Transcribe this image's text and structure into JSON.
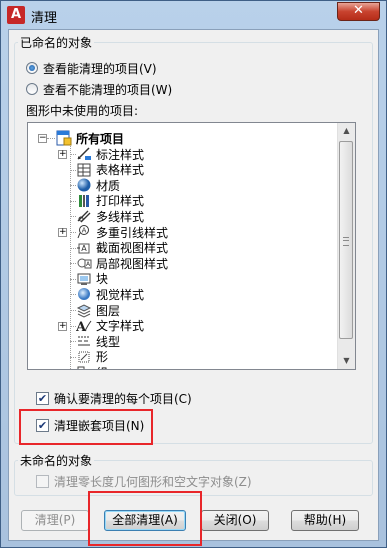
{
  "window": {
    "title": "清理",
    "app_icon_letter": "A",
    "close_glyph": "✕"
  },
  "named_objects": {
    "group_label": "已命名的对象",
    "radio_purgeable": {
      "label": "查看能清理的项目(V)",
      "selected": true
    },
    "radio_unpurgeable": {
      "label": "查看不能清理的项目(W)",
      "selected": false
    },
    "tree_label": "图形中未使用的项目:",
    "tree": {
      "root": {
        "label": "所有项目",
        "icon": "all-items-icon",
        "expander": "−"
      },
      "items": [
        {
          "label": "标注样式",
          "icon": "dimension-style-icon",
          "expandable": true
        },
        {
          "label": "表格样式",
          "icon": "table-style-icon",
          "expandable": false
        },
        {
          "label": "材质",
          "icon": "material-sphere-icon",
          "expandable": false
        },
        {
          "label": "打印样式",
          "icon": "plot-style-icon",
          "expandable": false
        },
        {
          "label": "多线样式",
          "icon": "multiline-style-icon",
          "expandable": false
        },
        {
          "label": "多重引线样式",
          "icon": "multileader-style-icon",
          "expandable": true
        },
        {
          "label": "截面视图样式",
          "icon": "section-view-style-icon",
          "expandable": false
        },
        {
          "label": "局部视图样式",
          "icon": "detail-view-style-icon",
          "expandable": false
        },
        {
          "label": "块",
          "icon": "block-icon",
          "expandable": false
        },
        {
          "label": "视觉样式",
          "icon": "visual-style-icon",
          "expandable": false
        },
        {
          "label": "图层",
          "icon": "layer-icon",
          "expandable": false
        },
        {
          "label": "文字样式",
          "icon": "text-style-icon",
          "expandable": true
        },
        {
          "label": "线型",
          "icon": "linetype-icon",
          "expandable": false
        },
        {
          "label": "形",
          "icon": "shape-icon",
          "expandable": false
        },
        {
          "label": "组",
          "icon": "group-icon",
          "expandable": false
        }
      ]
    },
    "confirm_each": {
      "label": "确认要清理的每个项目(C)",
      "checked": true
    },
    "purge_nested": {
      "label": "清理嵌套项目(N)",
      "checked": true
    }
  },
  "unnamed_objects": {
    "group_label": "未命名的对象",
    "purge_zero_length": {
      "label": "清理零长度几何图形和空文字对象(Z)",
      "checked": false,
      "enabled": false
    }
  },
  "buttons": {
    "purge": "清理(P)",
    "purge_all": "全部清理(A)",
    "close": "关闭(O)",
    "help": "帮助(H)"
  },
  "check_glyph": "✔",
  "colors": {
    "highlight": "#e8262a",
    "title_bar": "#b9d1ea",
    "client_bg": "#f0f0f0"
  }
}
